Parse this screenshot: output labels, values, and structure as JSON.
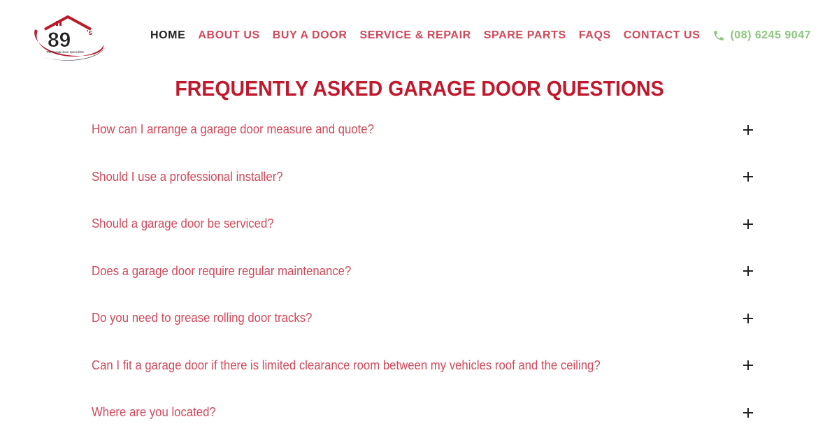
{
  "brand": {
    "logo_number": "89",
    "logo_suffix": "'s",
    "logo_tagline": "The Garage Door Specialists"
  },
  "nav": {
    "items": [
      {
        "label": "HOME",
        "active": true
      },
      {
        "label": "ABOUT US",
        "active": false
      },
      {
        "label": "BUY A DOOR",
        "active": false
      },
      {
        "label": "SERVICE & REPAIR",
        "active": false
      },
      {
        "label": "SPARE PARTS",
        "active": false
      },
      {
        "label": "FAQS",
        "active": false
      },
      {
        "label": "CONTACT US",
        "active": false
      }
    ],
    "phone": "(08) 6245 9047",
    "phone_icon": "phone-icon"
  },
  "faq": {
    "title": "FREQUENTLY ASKED GARAGE DOOR QUESTIONS",
    "toggle_icon": "plus-icon",
    "questions": [
      "How can I arrange a garage door measure and quote?",
      "Should I use a professional installer?",
      "Should a garage door be serviced?",
      "Does a garage door require regular maintenance?",
      "Do you need to grease rolling door tracks?",
      "Can I fit a garage door if there is limited clearance room between my vehicles roof and the ceiling?",
      "Where are you located?"
    ]
  },
  "colors": {
    "accent_red": "#c0182c",
    "link_pink": "#d0495c",
    "phone_green": "#8cc57d",
    "nav_active": "#222222"
  }
}
